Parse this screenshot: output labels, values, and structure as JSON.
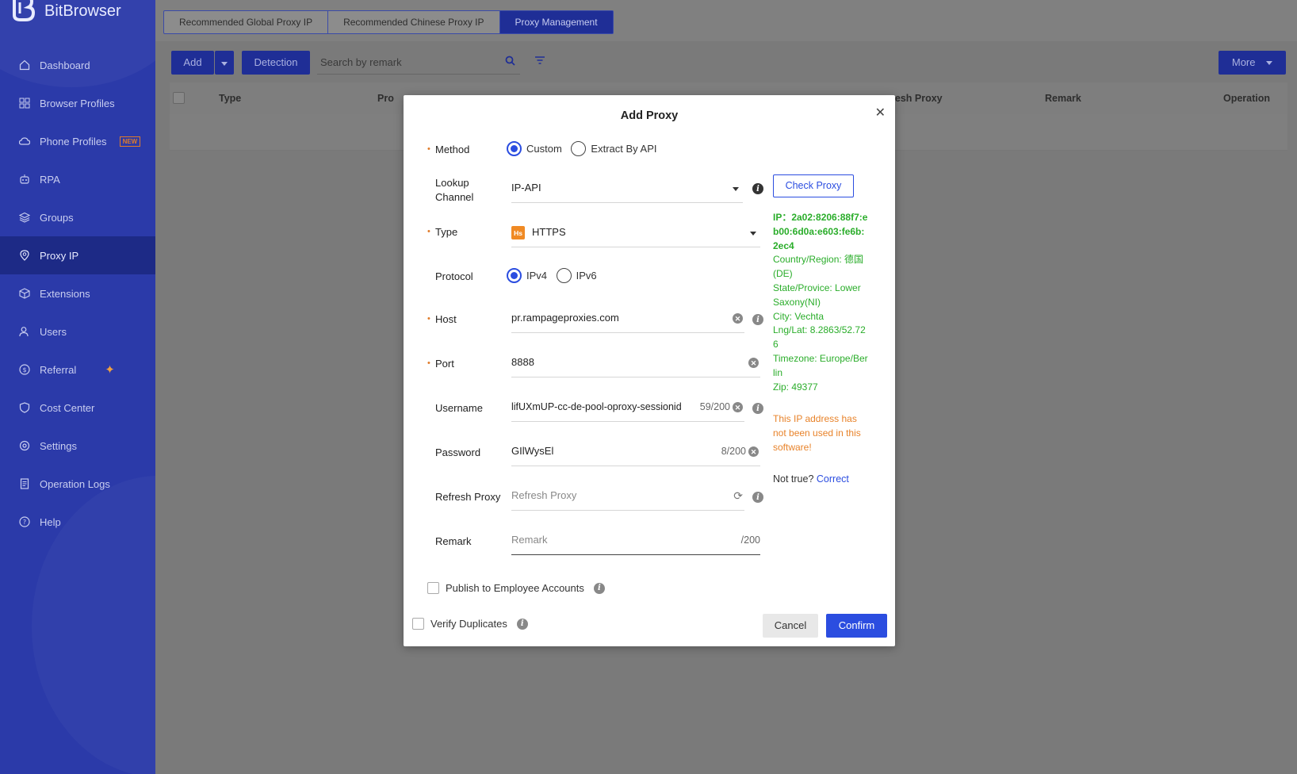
{
  "app": {
    "name": "BitBrowser"
  },
  "sidebar": {
    "items": [
      {
        "label": "Dashboard",
        "icon": "home-icon"
      },
      {
        "label": "Browser Profiles",
        "icon": "grid-icon"
      },
      {
        "label": "Phone Profiles",
        "icon": "cloud-phone-icon",
        "badge": "NEW"
      },
      {
        "label": "RPA",
        "icon": "robot-icon"
      },
      {
        "label": "Groups",
        "icon": "layers-icon"
      },
      {
        "label": "Proxy IP",
        "icon": "location-pin-icon",
        "active": true
      },
      {
        "label": "Extensions",
        "icon": "cube-icon"
      },
      {
        "label": "Users",
        "icon": "users-icon"
      },
      {
        "label": "Referral",
        "icon": "dollar-icon"
      },
      {
        "label": "Cost Center",
        "icon": "shield-icon"
      },
      {
        "label": "Settings",
        "icon": "gear-icon"
      },
      {
        "label": "Operation Logs",
        "icon": "document-icon"
      },
      {
        "label": "Help",
        "icon": "help-icon"
      }
    ]
  },
  "tabs": [
    "Recommended Global Proxy IP",
    "Recommended Chinese Proxy IP",
    "Proxy Management"
  ],
  "toolbar": {
    "add_label": "Add",
    "detection_label": "Detection",
    "search_placeholder": "Search by remark",
    "more_label": "More"
  },
  "table": {
    "headers": [
      "Type",
      "Pro",
      "resh Proxy",
      "Remark",
      "Operation"
    ]
  },
  "modal": {
    "title": "Add Proxy",
    "method": {
      "label": "Method",
      "options": [
        "Custom",
        "Extract By API"
      ],
      "selected": "Custom"
    },
    "lookup": {
      "label_line1": "Lookup",
      "label_line2": "Channel",
      "value": "IP-API"
    },
    "type": {
      "label": "Type",
      "icon_text": "Hs",
      "value": "HTTPS"
    },
    "protocol": {
      "label": "Protocol",
      "options": [
        "IPv4",
        "IPv6"
      ],
      "selected": "IPv4"
    },
    "host": {
      "label": "Host",
      "value": "pr.rampageproxies.com"
    },
    "port": {
      "label": "Port",
      "value": "8888"
    },
    "username": {
      "label": "Username",
      "value": "lifUXmUP-cc-de-pool-oproxy-sessionid",
      "count": "59/200"
    },
    "password": {
      "label": "Password",
      "value": "GIlWysEl",
      "count": "8/200"
    },
    "refresh": {
      "label": "Refresh Proxy",
      "placeholder": "Refresh Proxy"
    },
    "remark": {
      "label": "Remark",
      "placeholder": "Remark",
      "count": "/200"
    },
    "check_proxy_label": "Check Proxy",
    "ip_result": {
      "ip": "IP：2a02:8206:88f7:eb00:6d0a:e603:fe6b:2ec4",
      "country": "Country/Region: 德国(DE)",
      "state": "State/Provice: Lower Saxony(NI)",
      "city": "City: Vechta",
      "lnglat": "Lng/Lat: 8.2863/52.726",
      "timezone": "Timezone: Europe/Berlin",
      "zip": "Zip: 49377"
    },
    "warning": "This IP address has not been used in this software!",
    "not_true": "Not true?",
    "correct_label": "Correct",
    "publish_label": "Publish to Employee Accounts",
    "verify_label": "Verify Duplicates",
    "cancel_label": "Cancel",
    "confirm_label": "Confirm"
  },
  "colors": {
    "sidebar": "#2b3aa9",
    "primary": "#2b4de0",
    "success": "#2aad2a",
    "warning": "#e8832a"
  }
}
